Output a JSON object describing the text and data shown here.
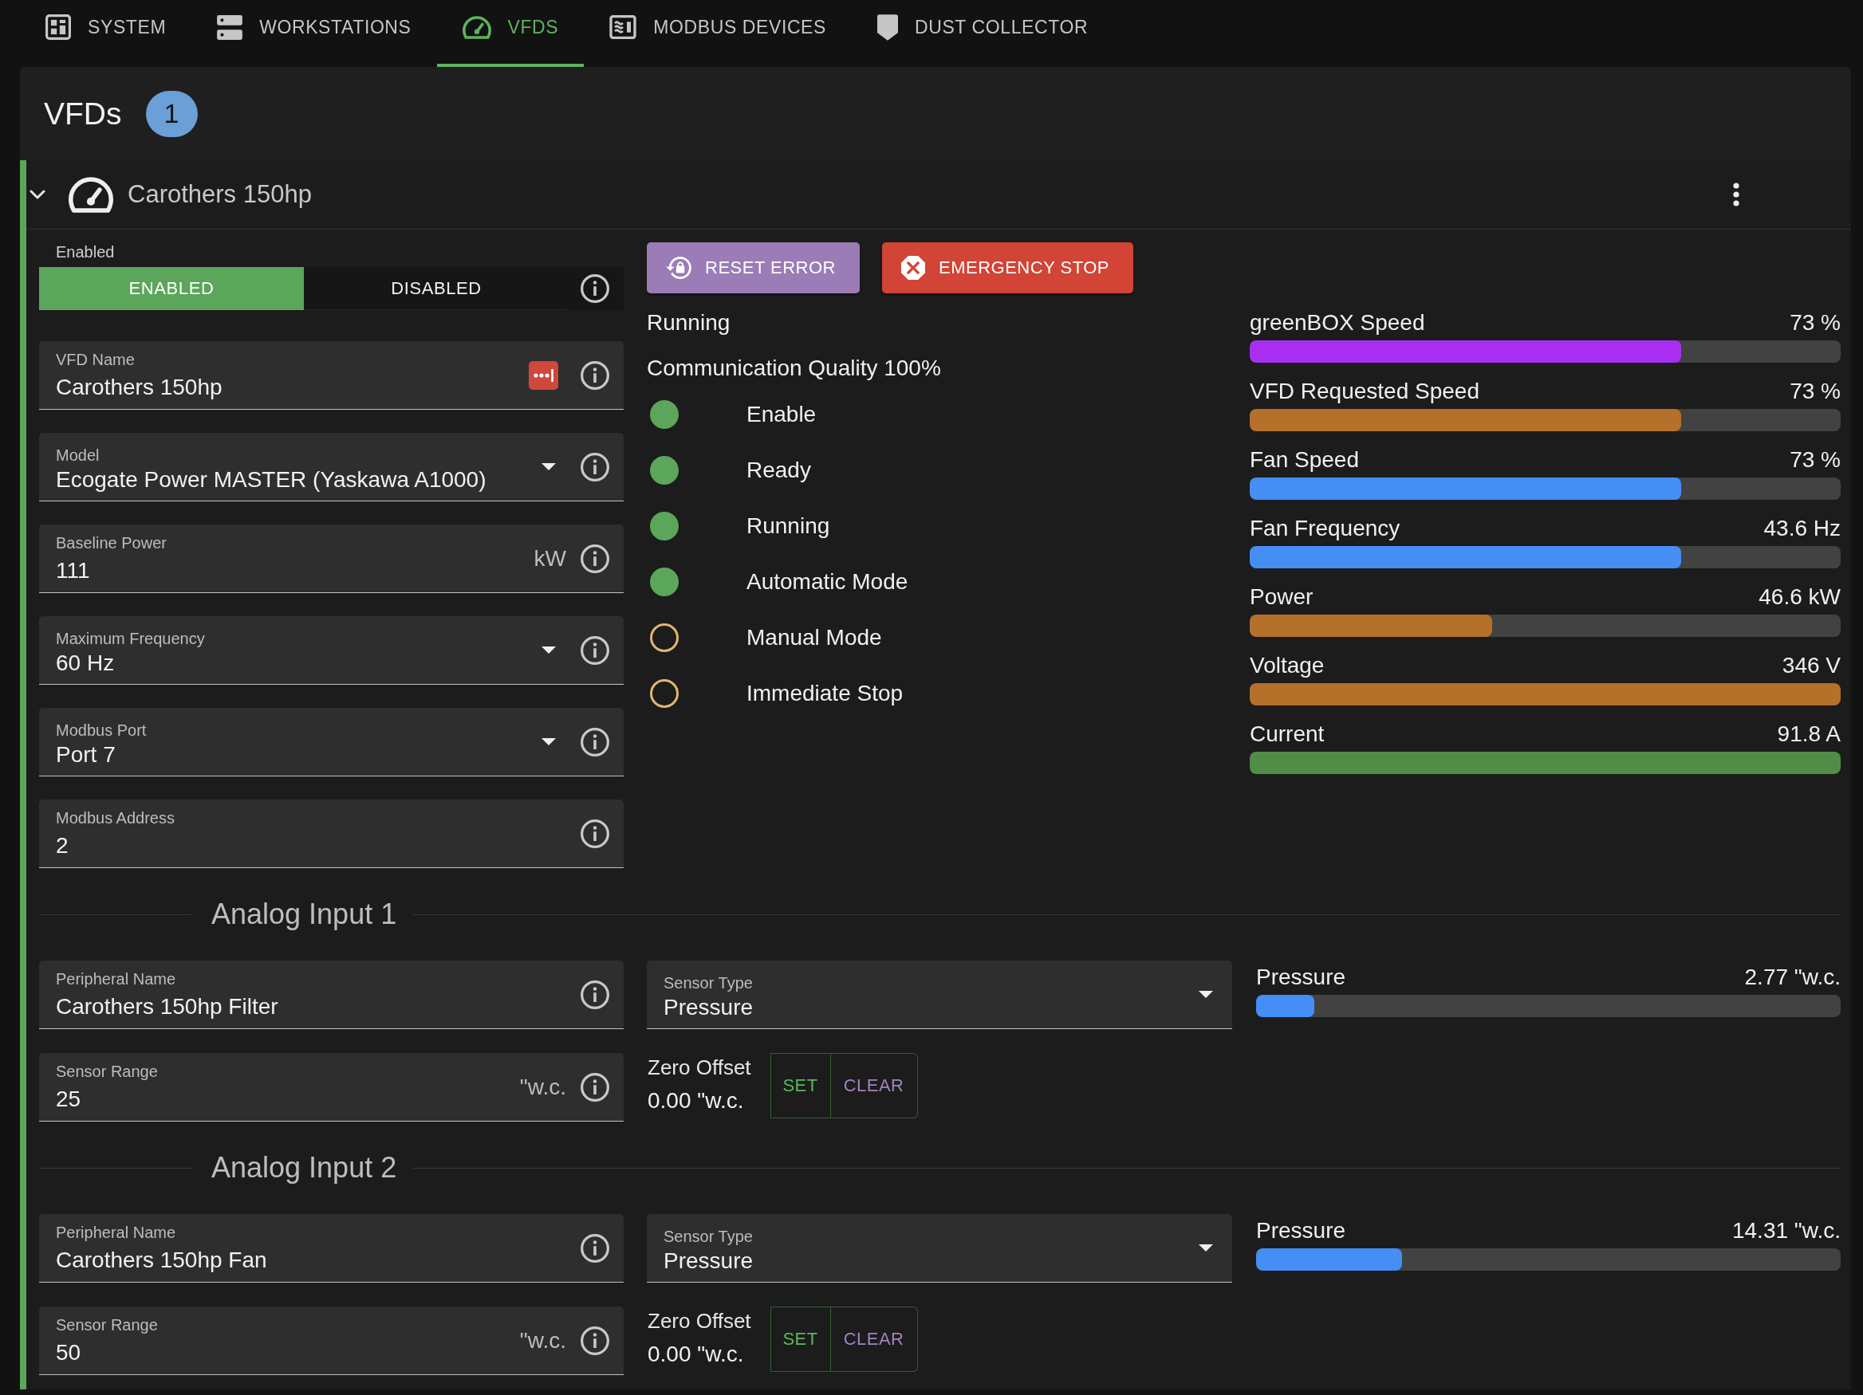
{
  "nav_tabs": [
    {
      "label": "SYSTEM",
      "selected": false
    },
    {
      "label": "WORKSTATIONS",
      "selected": false
    },
    {
      "label": "VFDS",
      "selected": true
    },
    {
      "label": "MODBUS DEVICES",
      "selected": false
    },
    {
      "label": "DUST COLLECTOR",
      "selected": false
    }
  ],
  "page_header": {
    "title": "VFDs",
    "count": "1"
  },
  "vfd": {
    "name": "Carothers 150hp",
    "expanded": true,
    "enabled_toggle": {
      "label": "Enabled",
      "options": [
        {
          "label": "ENABLED",
          "selected": true
        },
        {
          "label": "DISABLED",
          "selected": false
        }
      ]
    },
    "fields": [
      {
        "kind": "text",
        "label": "VFD Name",
        "value": "Carothers 150hp",
        "autofill": true
      },
      {
        "kind": "select",
        "label": "Model",
        "value": "Ecogate Power MASTER (Yaskawa A1000)",
        "autofill": false
      },
      {
        "kind": "text",
        "label": "Baseline Power",
        "value": "111",
        "suffix": "kW",
        "autofill": false
      },
      {
        "kind": "select",
        "label": "Maximum Frequency",
        "value": "60 Hz",
        "autofill": false
      },
      {
        "kind": "select",
        "label": "Modbus Port",
        "value": "Port 7",
        "autofill": false
      },
      {
        "kind": "text",
        "label": "Modbus Address",
        "value": "2",
        "autofill": false
      }
    ],
    "actions": [
      {
        "kind": "reset",
        "label": "RESET ERROR"
      },
      {
        "kind": "stop",
        "label": "EMERGENCY STOP"
      }
    ],
    "status": {
      "state": "Running",
      "communication": "Communication Quality 100%",
      "indicators": [
        {
          "label": "Enable",
          "on": true
        },
        {
          "label": "Ready",
          "on": true
        },
        {
          "label": "Running",
          "on": true
        },
        {
          "label": "Automatic Mode",
          "on": true
        },
        {
          "label": "Manual Mode",
          "on": false
        },
        {
          "label": "Immediate Stop",
          "on": false
        }
      ]
    },
    "meters": [
      {
        "label": "greenBOX Speed",
        "reading": "73 %",
        "level": 0.73,
        "color": "#a82ff1"
      },
      {
        "label": "VFD Requested Speed",
        "reading": "73 %",
        "level": 0.73,
        "color": "#b57029"
      },
      {
        "label": "Fan Speed",
        "reading": "73 %",
        "level": 0.73,
        "color": "#448ef6"
      },
      {
        "label": "Fan Frequency",
        "reading": "43.6 Hz",
        "level": 0.73,
        "color": "#448ef6"
      },
      {
        "label": "Power",
        "reading": "46.6 kW",
        "level": 0.41,
        "color": "#b57029"
      },
      {
        "label": "Voltage",
        "reading": "346 V",
        "level": 1,
        "color": "#b57029"
      },
      {
        "label": "Current",
        "reading": "91.8 A",
        "level": 1,
        "color": "#518d47"
      }
    ],
    "analog_inputs": [
      {
        "title": "Analog Input 1",
        "peripheral_name": {
          "label": "Peripheral Name",
          "value": "Carothers 150hp Filter"
        },
        "sensor_type": {
          "label": "Sensor Type",
          "value": "Pressure"
        },
        "sensor_range": {
          "label": "Sensor Range",
          "value": "25",
          "suffix": "\"w.c."
        },
        "zero_offset": {
          "label": "Zero Offset",
          "value": "0.00 \"w.c."
        },
        "offset_buttons": [
          {
            "kind": "set",
            "label": "SET"
          },
          {
            "kind": "clear",
            "label": "CLEAR"
          }
        ],
        "meter": {
          "label": "Pressure",
          "reading": "2.77 \"w.c.",
          "level": 0.1
        }
      },
      {
        "title": "Analog Input 2",
        "peripheral_name": {
          "label": "Peripheral Name",
          "value": "Carothers 150hp Fan"
        },
        "sensor_type": {
          "label": "Sensor Type",
          "value": "Pressure"
        },
        "sensor_range": {
          "label": "Sensor Range",
          "value": "50",
          "suffix": "\"w.c."
        },
        "zero_offset": {
          "label": "Zero Offset",
          "value": "0.00 \"w.c."
        },
        "offset_buttons": [
          {
            "kind": "set",
            "label": "SET"
          },
          {
            "kind": "clear",
            "label": "CLEAR"
          }
        ],
        "meter": {
          "label": "Pressure",
          "reading": "14.31 \"w.c.",
          "level": 0.25
        }
      }
    ]
  }
}
